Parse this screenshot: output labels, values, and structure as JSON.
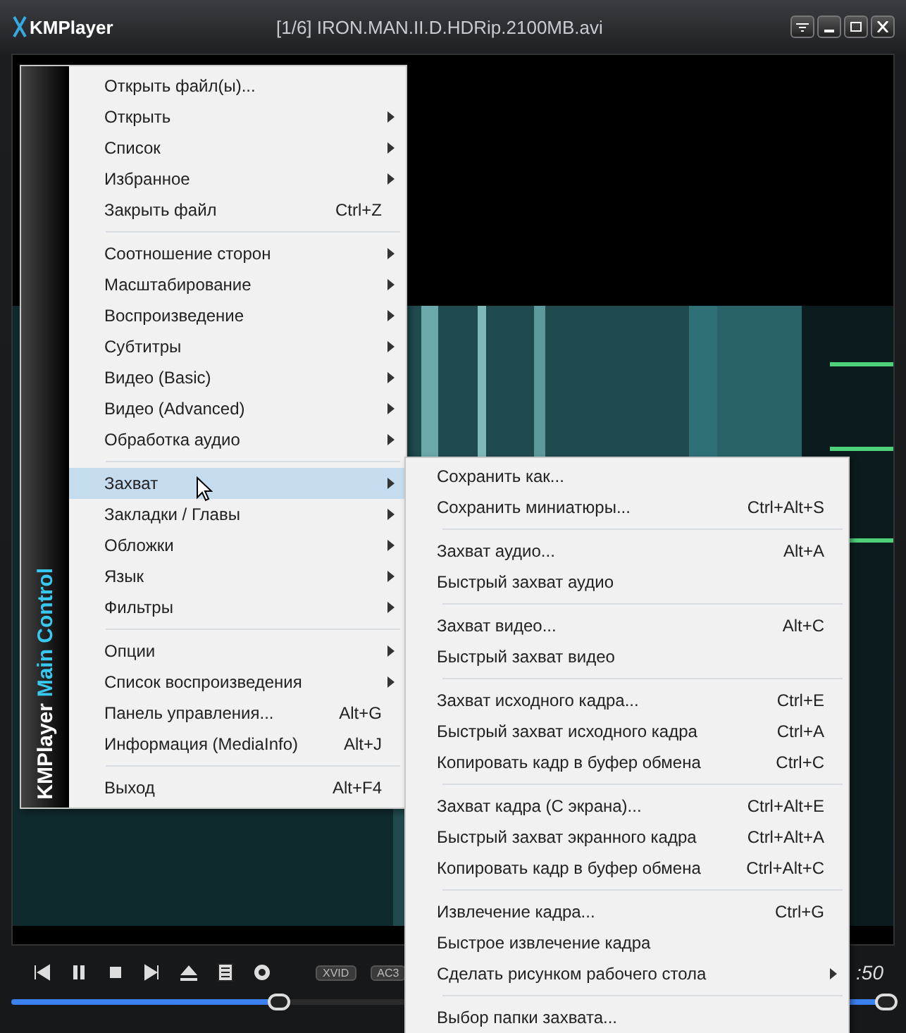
{
  "window": {
    "app_name": "KMPlayer",
    "title": "[1/6] IRON.MAN.II.D.HDRip.2100MB.avi"
  },
  "main_menu": {
    "sidebar_brand": "KMPlayer",
    "sidebar_label": "Main Control",
    "groups": [
      [
        {
          "label": "Открыть файл(ы)...",
          "has_submenu": false,
          "selected": false
        },
        {
          "label": "Открыть",
          "has_submenu": true,
          "selected": false
        },
        {
          "label": "Список",
          "has_submenu": true,
          "selected": false
        },
        {
          "label": "Избранное",
          "has_submenu": true,
          "selected": false
        },
        {
          "label": "Закрыть файл",
          "shortcut": "Ctrl+Z",
          "has_submenu": false,
          "selected": false
        }
      ],
      [
        {
          "label": "Соотношение сторон",
          "has_submenu": true,
          "selected": false
        },
        {
          "label": "Масштабирование",
          "has_submenu": true,
          "selected": false
        },
        {
          "label": "Воспроизведение",
          "has_submenu": true,
          "selected": false
        },
        {
          "label": "Субтитры",
          "has_submenu": true,
          "selected": false
        },
        {
          "label": "Видео (Basic)",
          "has_submenu": true,
          "selected": false
        },
        {
          "label": "Видео (Advanced)",
          "has_submenu": true,
          "selected": false
        },
        {
          "label": "Обработка аудио",
          "has_submenu": true,
          "selected": false
        }
      ],
      [
        {
          "label": "Захват",
          "has_submenu": true,
          "selected": true
        },
        {
          "label": "Закладки / Главы",
          "has_submenu": true,
          "selected": false
        },
        {
          "label": "Обложки",
          "has_submenu": true,
          "selected": false
        },
        {
          "label": "Язык",
          "has_submenu": true,
          "selected": false
        },
        {
          "label": "Фильтры",
          "has_submenu": true,
          "selected": false
        }
      ],
      [
        {
          "label": "Опции",
          "has_submenu": true,
          "selected": false
        },
        {
          "label": "Список воспроизведения",
          "has_submenu": true,
          "selected": false
        },
        {
          "label": "Панель управления...",
          "shortcut": "Alt+G",
          "has_submenu": false,
          "selected": false
        },
        {
          "label": "Информация (MediaInfo)",
          "shortcut": "Alt+J",
          "has_submenu": false,
          "selected": false
        }
      ],
      [
        {
          "label": "Выход",
          "shortcut": "Alt+F4",
          "has_submenu": false,
          "selected": false
        }
      ]
    ]
  },
  "capture_submenu": {
    "groups": [
      [
        {
          "label": "Сохранить как...",
          "has_submenu": false
        },
        {
          "label": "Сохранить миниатюры...",
          "shortcut": "Ctrl+Alt+S",
          "has_submenu": false
        }
      ],
      [
        {
          "label": "Захват аудио...",
          "shortcut": "Alt+A",
          "has_submenu": false
        },
        {
          "label": "Быстрый захват аудио",
          "has_submenu": false
        }
      ],
      [
        {
          "label": "Захват видео...",
          "shortcut": "Alt+C",
          "has_submenu": false
        },
        {
          "label": "Быстрый захват видео",
          "has_submenu": false
        }
      ],
      [
        {
          "label": "Захват исходного кадра...",
          "shortcut": "Ctrl+E",
          "has_submenu": false
        },
        {
          "label": "Быстрый захват исходного кадра",
          "shortcut": "Ctrl+A",
          "has_submenu": false
        },
        {
          "label": "Копировать кадр в буфер обмена",
          "shortcut": "Ctrl+C",
          "has_submenu": false
        }
      ],
      [
        {
          "label": "Захват кадра (С экрана)...",
          "shortcut": "Ctrl+Alt+E",
          "has_submenu": false
        },
        {
          "label": "Быстрый захват экранного кадра",
          "shortcut": "Ctrl+Alt+A",
          "has_submenu": false
        },
        {
          "label": "Копировать кадр в буфер обмена",
          "shortcut": "Ctrl+Alt+C",
          "has_submenu": false
        }
      ],
      [
        {
          "label": "Извлечение кадра...",
          "shortcut": "Ctrl+G",
          "has_submenu": false
        },
        {
          "label": "Быстрое извлечение кадра",
          "has_submenu": false
        },
        {
          "label": "Сделать рисунком рабочего стола",
          "has_submenu": true
        }
      ],
      [
        {
          "label": "Выбор папки захвата...",
          "has_submenu": false
        }
      ]
    ]
  },
  "controls": {
    "codec_badges": [
      "XVID",
      "AC3"
    ],
    "time": ":50",
    "seek": {
      "level": 0.33
    },
    "volume": {
      "level": 0.8
    }
  }
}
